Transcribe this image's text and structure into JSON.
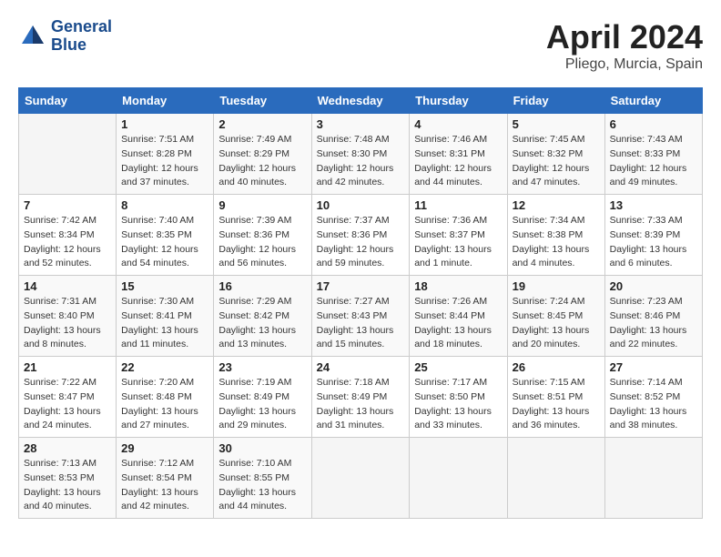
{
  "logo": {
    "line1": "General",
    "line2": "Blue"
  },
  "title": "April 2024",
  "location": "Pliego, Murcia, Spain",
  "days_of_week": [
    "Sunday",
    "Monday",
    "Tuesday",
    "Wednesday",
    "Thursday",
    "Friday",
    "Saturday"
  ],
  "weeks": [
    [
      {
        "num": "",
        "info": ""
      },
      {
        "num": "1",
        "info": "Sunrise: 7:51 AM\nSunset: 8:28 PM\nDaylight: 12 hours\nand 37 minutes."
      },
      {
        "num": "2",
        "info": "Sunrise: 7:49 AM\nSunset: 8:29 PM\nDaylight: 12 hours\nand 40 minutes."
      },
      {
        "num": "3",
        "info": "Sunrise: 7:48 AM\nSunset: 8:30 PM\nDaylight: 12 hours\nand 42 minutes."
      },
      {
        "num": "4",
        "info": "Sunrise: 7:46 AM\nSunset: 8:31 PM\nDaylight: 12 hours\nand 44 minutes."
      },
      {
        "num": "5",
        "info": "Sunrise: 7:45 AM\nSunset: 8:32 PM\nDaylight: 12 hours\nand 47 minutes."
      },
      {
        "num": "6",
        "info": "Sunrise: 7:43 AM\nSunset: 8:33 PM\nDaylight: 12 hours\nand 49 minutes."
      }
    ],
    [
      {
        "num": "7",
        "info": "Sunrise: 7:42 AM\nSunset: 8:34 PM\nDaylight: 12 hours\nand 52 minutes."
      },
      {
        "num": "8",
        "info": "Sunrise: 7:40 AM\nSunset: 8:35 PM\nDaylight: 12 hours\nand 54 minutes."
      },
      {
        "num": "9",
        "info": "Sunrise: 7:39 AM\nSunset: 8:36 PM\nDaylight: 12 hours\nand 56 minutes."
      },
      {
        "num": "10",
        "info": "Sunrise: 7:37 AM\nSunset: 8:36 PM\nDaylight: 12 hours\nand 59 minutes."
      },
      {
        "num": "11",
        "info": "Sunrise: 7:36 AM\nSunset: 8:37 PM\nDaylight: 13 hours\nand 1 minute."
      },
      {
        "num": "12",
        "info": "Sunrise: 7:34 AM\nSunset: 8:38 PM\nDaylight: 13 hours\nand 4 minutes."
      },
      {
        "num": "13",
        "info": "Sunrise: 7:33 AM\nSunset: 8:39 PM\nDaylight: 13 hours\nand 6 minutes."
      }
    ],
    [
      {
        "num": "14",
        "info": "Sunrise: 7:31 AM\nSunset: 8:40 PM\nDaylight: 13 hours\nand 8 minutes."
      },
      {
        "num": "15",
        "info": "Sunrise: 7:30 AM\nSunset: 8:41 PM\nDaylight: 13 hours\nand 11 minutes."
      },
      {
        "num": "16",
        "info": "Sunrise: 7:29 AM\nSunset: 8:42 PM\nDaylight: 13 hours\nand 13 minutes."
      },
      {
        "num": "17",
        "info": "Sunrise: 7:27 AM\nSunset: 8:43 PM\nDaylight: 13 hours\nand 15 minutes."
      },
      {
        "num": "18",
        "info": "Sunrise: 7:26 AM\nSunset: 8:44 PM\nDaylight: 13 hours\nand 18 minutes."
      },
      {
        "num": "19",
        "info": "Sunrise: 7:24 AM\nSunset: 8:45 PM\nDaylight: 13 hours\nand 20 minutes."
      },
      {
        "num": "20",
        "info": "Sunrise: 7:23 AM\nSunset: 8:46 PM\nDaylight: 13 hours\nand 22 minutes."
      }
    ],
    [
      {
        "num": "21",
        "info": "Sunrise: 7:22 AM\nSunset: 8:47 PM\nDaylight: 13 hours\nand 24 minutes."
      },
      {
        "num": "22",
        "info": "Sunrise: 7:20 AM\nSunset: 8:48 PM\nDaylight: 13 hours\nand 27 minutes."
      },
      {
        "num": "23",
        "info": "Sunrise: 7:19 AM\nSunset: 8:49 PM\nDaylight: 13 hours\nand 29 minutes."
      },
      {
        "num": "24",
        "info": "Sunrise: 7:18 AM\nSunset: 8:49 PM\nDaylight: 13 hours\nand 31 minutes."
      },
      {
        "num": "25",
        "info": "Sunrise: 7:17 AM\nSunset: 8:50 PM\nDaylight: 13 hours\nand 33 minutes."
      },
      {
        "num": "26",
        "info": "Sunrise: 7:15 AM\nSunset: 8:51 PM\nDaylight: 13 hours\nand 36 minutes."
      },
      {
        "num": "27",
        "info": "Sunrise: 7:14 AM\nSunset: 8:52 PM\nDaylight: 13 hours\nand 38 minutes."
      }
    ],
    [
      {
        "num": "28",
        "info": "Sunrise: 7:13 AM\nSunset: 8:53 PM\nDaylight: 13 hours\nand 40 minutes."
      },
      {
        "num": "29",
        "info": "Sunrise: 7:12 AM\nSunset: 8:54 PM\nDaylight: 13 hours\nand 42 minutes."
      },
      {
        "num": "30",
        "info": "Sunrise: 7:10 AM\nSunset: 8:55 PM\nDaylight: 13 hours\nand 44 minutes."
      },
      {
        "num": "",
        "info": ""
      },
      {
        "num": "",
        "info": ""
      },
      {
        "num": "",
        "info": ""
      },
      {
        "num": "",
        "info": ""
      }
    ]
  ]
}
